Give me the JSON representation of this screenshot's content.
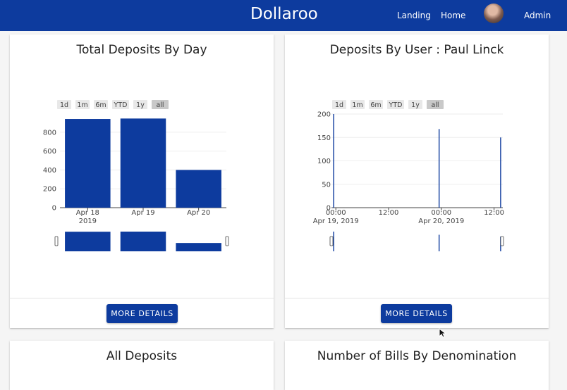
{
  "header": {
    "brand": "Dollaroo",
    "nav": [
      "Landing",
      "Home",
      "Admin"
    ]
  },
  "colors": {
    "primary": "#0d3b9e",
    "bar": "#0d3b9e",
    "selector_bg": "#e8e8e8",
    "selector_active": "#c9c9c9"
  },
  "icons": {
    "avatar": "user-avatar",
    "cursor": "mouse-pointer-icon"
  },
  "range_selector": [
    "1d",
    "1m",
    "6m",
    "YTD",
    "1y",
    "all"
  ],
  "range_active": "all",
  "cards": [
    {
      "title": "Total Deposits By Day",
      "button": "MORE DETAILS"
    },
    {
      "title": "Deposits By User : Paul Linck",
      "button": "MORE DETAILS"
    },
    {
      "title": "All Deposits"
    },
    {
      "title": "Number of Bills By Denomination"
    }
  ],
  "chart_data": [
    {
      "type": "bar",
      "categories": [
        "Apr 18",
        "Apr 19",
        "Apr 20"
      ],
      "category_sublabels": [
        "2019",
        "",
        ""
      ],
      "values": [
        940,
        945,
        400
      ],
      "ylim": [
        0,
        1000
      ],
      "yticks": [
        0,
        200,
        400,
        600,
        800
      ],
      "grid": true
    },
    {
      "type": "bar",
      "x_ticks": [
        {
          "label": "00:00",
          "sub": "Apr 19, 2019"
        },
        {
          "label": "12:00",
          "sub": ""
        },
        {
          "label": "00:00",
          "sub": "Apr 20, 2019"
        },
        {
          "label": "12:00",
          "sub": ""
        }
      ],
      "x_hours": [
        0,
        12,
        24,
        36
      ],
      "xlim_hours": [
        -1,
        38
      ],
      "points": [
        {
          "hour": -0.5,
          "value": 200
        },
        {
          "hour": 23.5,
          "value": 168
        },
        {
          "hour": 37.5,
          "value": 150
        }
      ],
      "ylim": [
        0,
        200
      ],
      "yticks": [
        0,
        50,
        100,
        150,
        200
      ],
      "grid": true
    }
  ]
}
